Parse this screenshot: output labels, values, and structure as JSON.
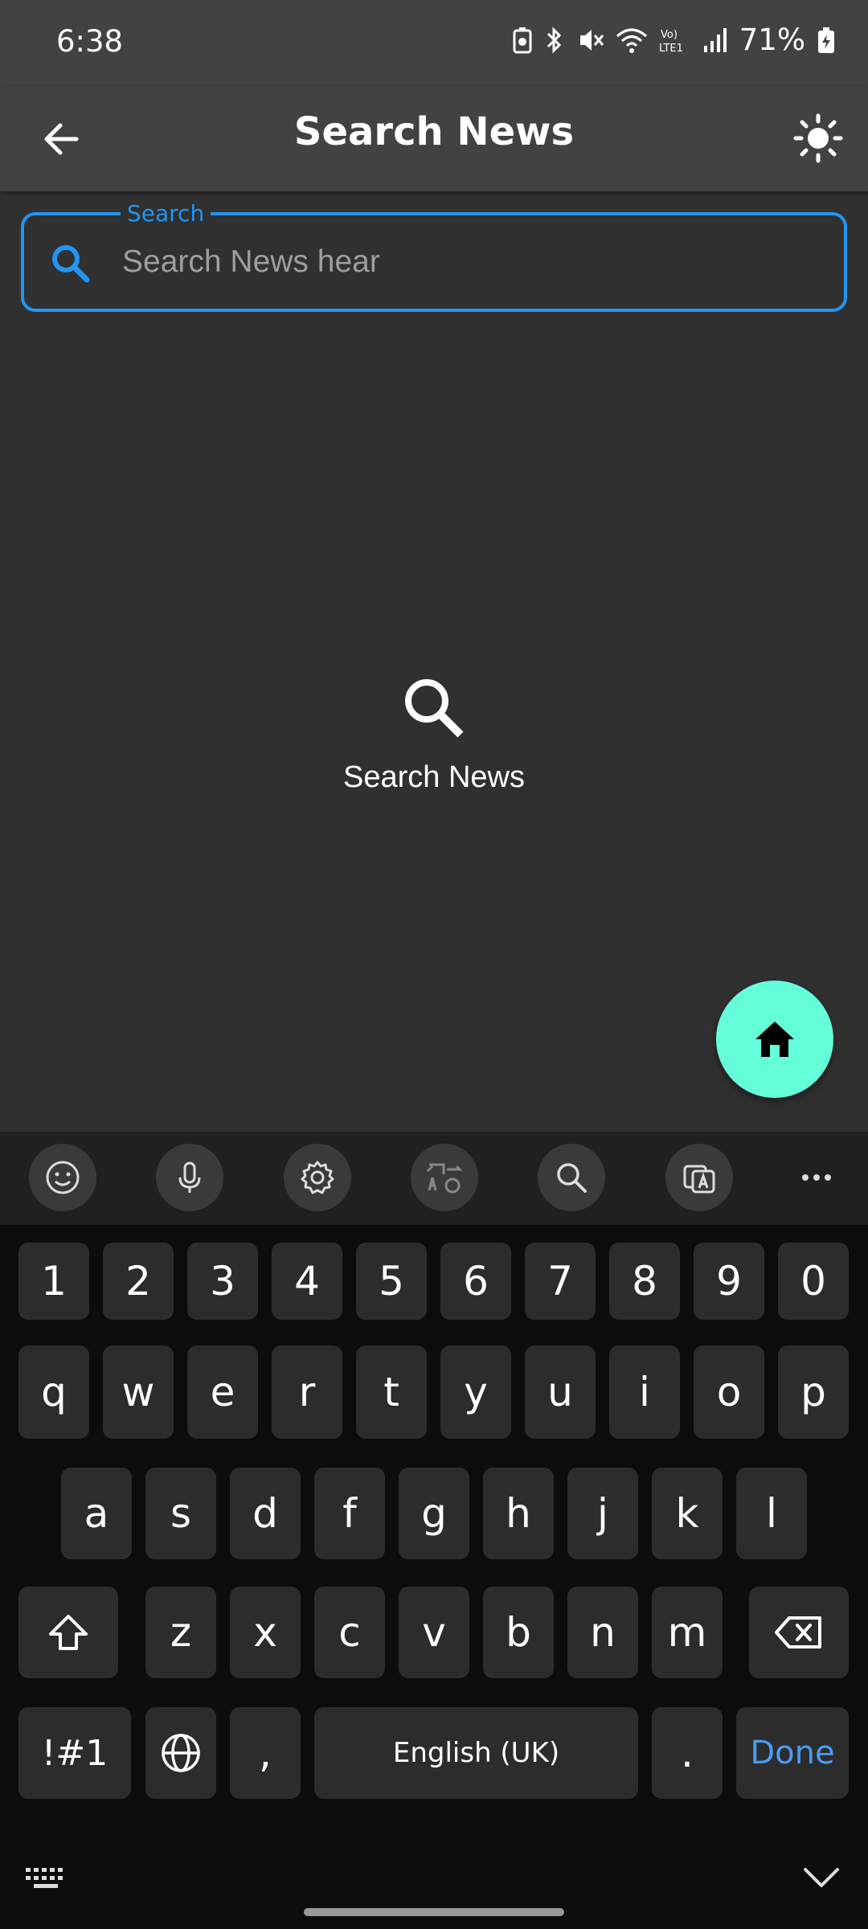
{
  "status_bar": {
    "time": "6:38",
    "battery": "71%",
    "network_label": "Vo) LTE1"
  },
  "app_bar": {
    "title": "Search News",
    "back_icon": "arrow-back-icon",
    "theme_icon": "sun-icon"
  },
  "search": {
    "label": "Search",
    "placeholder": "Search News hear",
    "value": ""
  },
  "empty_state": {
    "icon": "search-icon",
    "text": "Search News"
  },
  "fab": {
    "icon": "home-icon",
    "color": "#64FFDA"
  },
  "keyboard": {
    "toolbar": [
      "emoji-icon",
      "microphone-icon",
      "settings-icon",
      "translate-icon",
      "search-icon",
      "image-translate-icon",
      "more-icon"
    ],
    "number_row": [
      "1",
      "2",
      "3",
      "4",
      "5",
      "6",
      "7",
      "8",
      "9",
      "0"
    ],
    "row1": [
      "q",
      "w",
      "e",
      "r",
      "t",
      "y",
      "u",
      "i",
      "o",
      "p"
    ],
    "row2": [
      "a",
      "s",
      "d",
      "f",
      "g",
      "h",
      "j",
      "k",
      "l"
    ],
    "row3": [
      "z",
      "x",
      "c",
      "v",
      "b",
      "n",
      "m"
    ],
    "symbols_key": "!#1",
    "comma_key": ",",
    "space_label": "English (UK)",
    "period_key": ".",
    "done_label": "Done"
  },
  "colors": {
    "accent": "#2196F3",
    "app_bar": "#424242",
    "background": "#303030"
  }
}
